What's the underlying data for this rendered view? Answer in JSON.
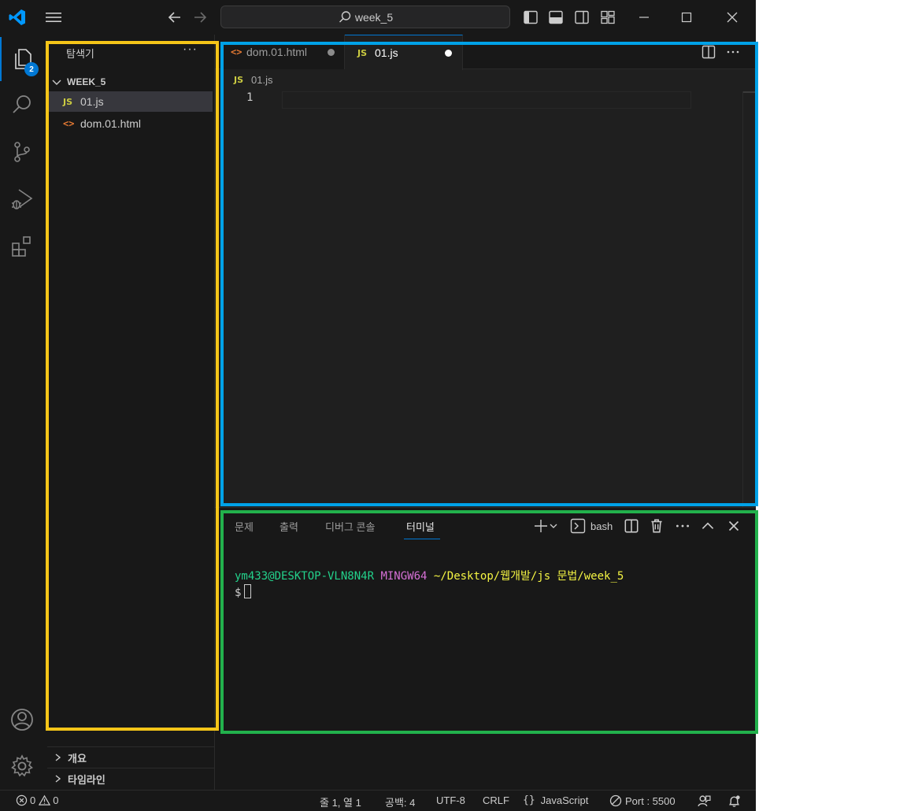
{
  "titlebar": {
    "search_text": "week_5"
  },
  "activity": {
    "explorer_badge": "2"
  },
  "sidebar": {
    "title": "탐색기",
    "more": "···",
    "folder": "WEEK_5",
    "files": [
      {
        "icon": "JS",
        "name": "01.js",
        "selected": true
      },
      {
        "icon": "<>",
        "name": "dom.01.html",
        "selected": false
      }
    ],
    "sections": [
      "개요",
      "타임라인"
    ]
  },
  "editor": {
    "tabs": [
      {
        "icon": "<>",
        "label": "dom.01.html",
        "active": false
      },
      {
        "icon": "JS",
        "label": "01.js",
        "active": true
      }
    ],
    "breadcrumb_icon": "JS",
    "breadcrumb": "01.js",
    "line_number": "1"
  },
  "panel": {
    "tabs": [
      "문제",
      "출력",
      "디버그 콘솔",
      "터미널"
    ],
    "active_tab": "터미널",
    "shell_label": "bash",
    "terminal": {
      "user": "ym433@DESKTOP-VLN8N4R",
      "system": "MINGW64",
      "path": "~/Desktop/웹개발/js 문법/week_5",
      "prompt": "$"
    }
  },
  "statusbar": {
    "errors": "0",
    "warnings": "0",
    "position": "줄 1, 열 1",
    "spaces": "공백: 4",
    "encoding": "UTF-8",
    "eol": "CRLF",
    "language_braces": "{}",
    "language": "JavaScript",
    "port": "Port : 5500"
  },
  "colors": {
    "accent": "#0078d4",
    "annotation_yellow": "#f5c518",
    "annotation_blue": "#00a2e8",
    "annotation_green": "#22b14c"
  }
}
